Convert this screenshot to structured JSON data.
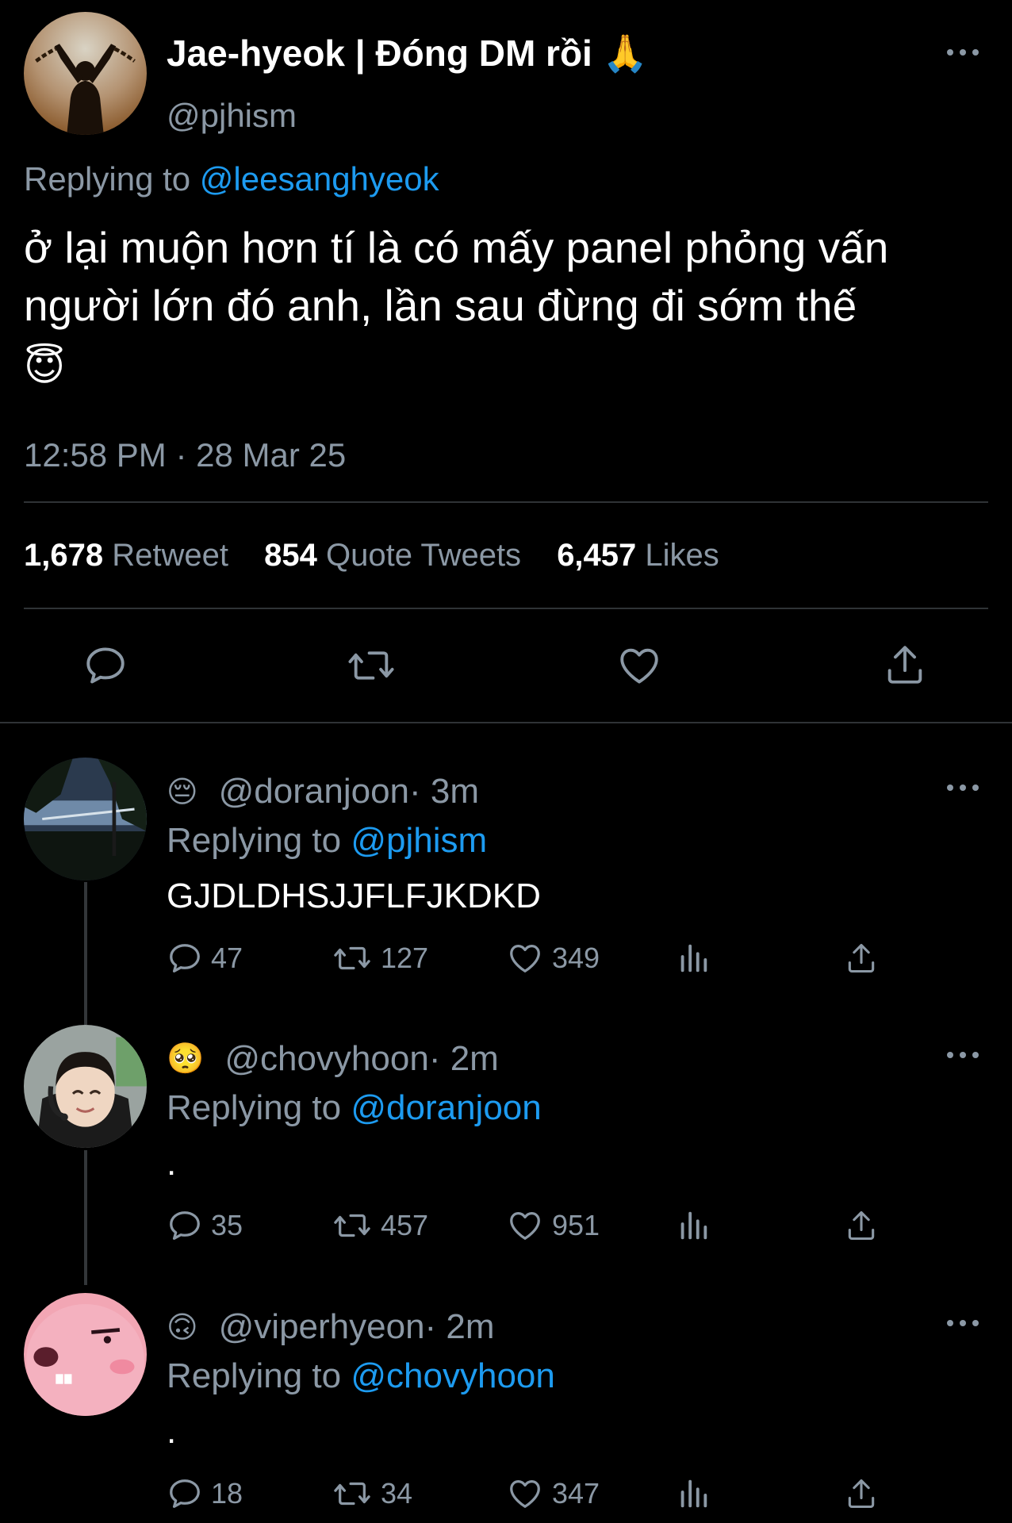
{
  "main_tweet": {
    "display_name": "Jae-hyeok | Đóng DM rồi",
    "display_name_emoji": "🙏",
    "handle": "@pjhism",
    "replying_label": "Replying to ",
    "replying_to": "@leesanghyeok",
    "text": "ở lại muộn hơn tí là có mấy panel phỏng vấn người lớn đó anh, lần sau đừng đi sớm thế",
    "text_emoji": "😇",
    "timestamp": "12:58 PM · 28 Mar 25",
    "stats": {
      "retweets_count": "1,678",
      "retweets_label": "Retweet",
      "quotes_count": "854",
      "quotes_label": "Quote Tweets",
      "likes_count": "6,457",
      "likes_label": "Likes"
    }
  },
  "replies": [
    {
      "emoji": "😔",
      "handle": "@doranjoon",
      "time": " · 3m",
      "replying_label": "Replying to ",
      "replying_to": "@pjhism",
      "text": "GJDLDHSJJFLFJKDKD",
      "replies": "47",
      "retweets": "127",
      "likes": "349"
    },
    {
      "emoji": "🥺",
      "handle": "@chovyhoon",
      "time": " · 2m",
      "replying_label": "Replying to ",
      "replying_to": "@doranjoon",
      "text": ".",
      "replies": "35",
      "retweets": "457",
      "likes": "951"
    },
    {
      "emoji": "🙃",
      "handle": "@viperhyeon",
      "time": " · 2m",
      "replying_label": "Replying to ",
      "replying_to": "@chovyhoon",
      "text": ".",
      "replies": "18",
      "retweets": "34",
      "likes": "347"
    }
  ],
  "colors": {
    "background": "#000000",
    "text": "#e7e9ea",
    "secondary": "#8b98a5",
    "link": "#1d9bf0",
    "divider": "#2f3336"
  },
  "icons": {
    "reply": "reply-bubble-icon",
    "retweet": "retweet-icon",
    "like": "heart-icon",
    "share": "share-icon",
    "views": "analytics-icon",
    "more": "more-dots-icon"
  }
}
